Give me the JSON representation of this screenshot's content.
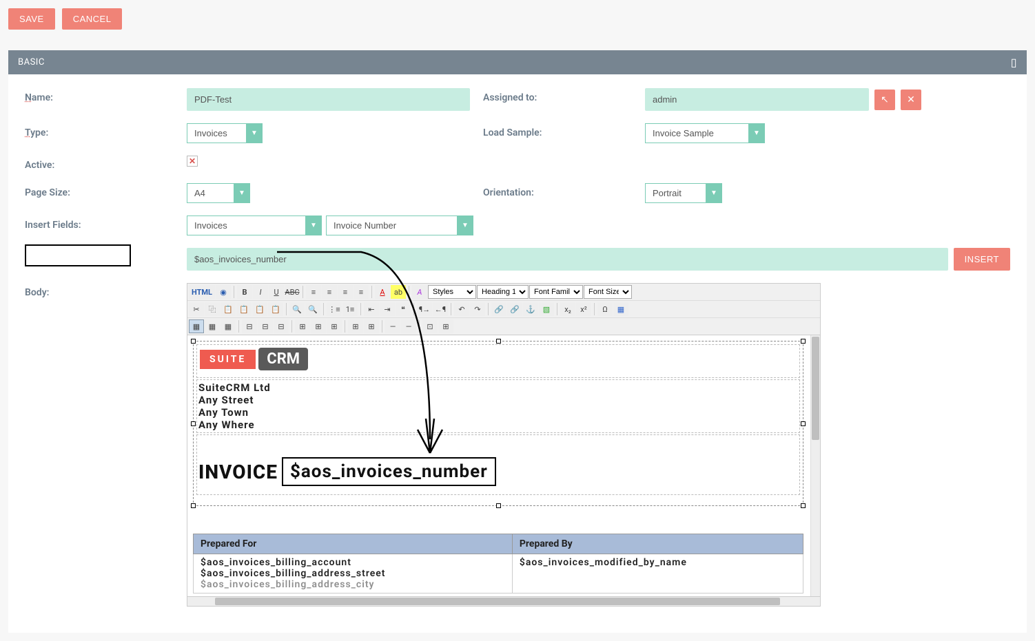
{
  "topbar": {
    "save": "SAVE",
    "cancel": "CANCEL"
  },
  "panel": {
    "title": "BASIC"
  },
  "fields": {
    "name_label": "Name:",
    "name_value": "PDF-Test",
    "assigned_label": "Assigned to:",
    "assigned_value": "admin",
    "type_label": "Type:",
    "type_value": "Invoices",
    "load_sample_label": "Load Sample:",
    "load_sample_value": "Invoice Sample",
    "active_label": "Active:",
    "page_size_label": "Page Size:",
    "page_size_value": "A4",
    "orientation_label": "Orientation:",
    "orientation_value": "Portrait",
    "insert_fields_label": "Insert Fields:",
    "insert_module_value": "Invoices",
    "insert_field_value": "Invoice Number",
    "variable_value": "$aos_invoices_number",
    "insert_button": "INSERT",
    "body_label": "Body:"
  },
  "editor": {
    "styles_label": "Styles",
    "heading_label": "Heading 1",
    "font_family_label": "Font Family",
    "font_size_label": "Font Size"
  },
  "document": {
    "logo_suite": "SUITE",
    "logo_crm": "CRM",
    "address": [
      "SuiteCRM Ltd",
      "Any Street",
      "Any Town",
      "Any Where"
    ],
    "invoice_label": "INVOICE",
    "invoice_var": "$aos_invoices_number",
    "table_headers": [
      "Prepared For",
      "Prepared By"
    ],
    "prepared_for": [
      "$aos_invoices_billing_account",
      "$aos_invoices_billing_address_street",
      "$aos_invoices_billing_address_city"
    ],
    "prepared_by": [
      "$aos_invoices_modified_by_name"
    ]
  }
}
